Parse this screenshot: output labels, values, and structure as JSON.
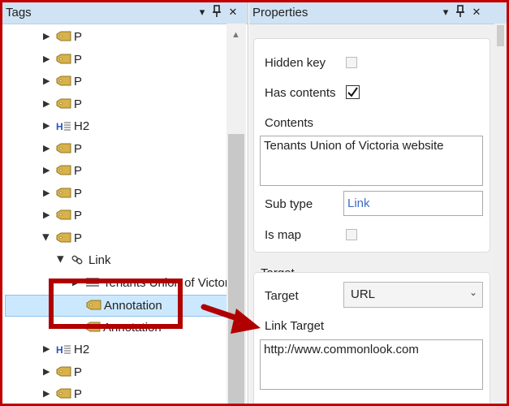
{
  "tags_panel": {
    "title": "Tags",
    "tree": [
      {
        "label": "P",
        "icon": "tag-icon",
        "twisty": "right",
        "indent": 0
      },
      {
        "label": "P",
        "icon": "tag-icon",
        "twisty": "right",
        "indent": 0
      },
      {
        "label": "P",
        "icon": "tag-icon",
        "twisty": "right",
        "indent": 0
      },
      {
        "label": "P",
        "icon": "tag-icon",
        "twisty": "right",
        "indent": 0
      },
      {
        "label": "H2",
        "icon": "heading-icon",
        "twisty": "right",
        "indent": 0
      },
      {
        "label": "P",
        "icon": "tag-icon",
        "twisty": "right",
        "indent": 0
      },
      {
        "label": "P",
        "icon": "tag-icon",
        "twisty": "right",
        "indent": 0
      },
      {
        "label": "P",
        "icon": "tag-icon",
        "twisty": "right",
        "indent": 0
      },
      {
        "label": "P",
        "icon": "tag-icon",
        "twisty": "right",
        "indent": 0
      },
      {
        "label": "P",
        "icon": "tag-icon",
        "twisty": "down",
        "indent": 0
      },
      {
        "label": "Link",
        "icon": "link-icon",
        "twisty": "down",
        "indent": 1
      },
      {
        "label": "Tenants Union of Victor",
        "icon": "text-icon",
        "twisty": "right",
        "indent": 2
      },
      {
        "label": "Annotation",
        "icon": "tag-icon",
        "twisty": "none",
        "indent": 2,
        "selected": true
      },
      {
        "label": "Annotation",
        "icon": "tag-icon",
        "twisty": "none",
        "indent": 2
      },
      {
        "label": "H2",
        "icon": "heading-icon",
        "twisty": "right",
        "indent": 0
      },
      {
        "label": "P",
        "icon": "tag-icon",
        "twisty": "right",
        "indent": 0
      },
      {
        "label": "P",
        "icon": "tag-icon",
        "twisty": "right",
        "indent": 0
      }
    ]
  },
  "properties_panel": {
    "title": "Properties",
    "hidden_key": {
      "label": "Hidden key",
      "checked": false
    },
    "has_contents": {
      "label": "Has contents",
      "checked": true
    },
    "contents": {
      "label": "Contents",
      "value": "Tenants Union of Victoria website"
    },
    "sub_type": {
      "label": "Sub type",
      "value": "Link"
    },
    "is_map": {
      "label": "Is map",
      "checked": false
    },
    "target_section": {
      "heading": "Target",
      "target": {
        "label": "Target",
        "value": "URL"
      },
      "link_target": {
        "label": "Link Target",
        "value": "http://www.commonlook.com"
      }
    }
  },
  "icons": {
    "dropdown": "▾",
    "pin": "📌",
    "close": "✕",
    "twisty_right": "▶",
    "chevron_down": "⌄",
    "scroll_up": "▲"
  },
  "colors": {
    "frame": "#c00000",
    "selection": "#cce8ff",
    "header": "#cfe3f4",
    "annotation_red": "#b00000",
    "tag_gold": "#d8b24a"
  }
}
